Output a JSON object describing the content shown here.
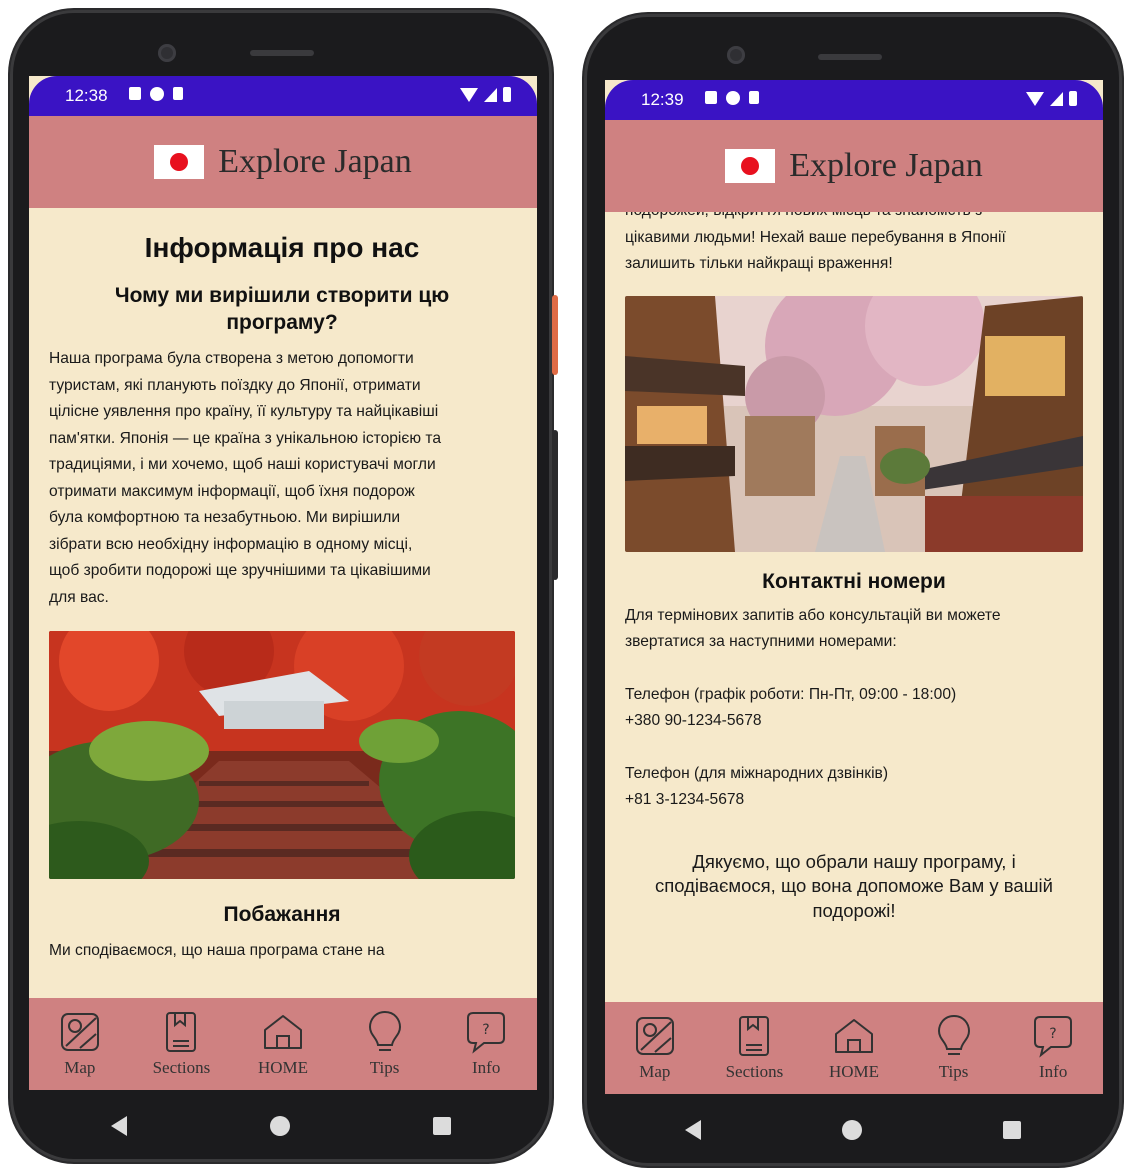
{
  "app": {
    "title": "Explore Japan"
  },
  "colors": {
    "statusbar": "#3a13c4",
    "appbar": "#cf8181",
    "background": "#f6e9cb",
    "flag_red": "#e8101e"
  },
  "left": {
    "status_time": "12:38",
    "page_title": "Інформація про нас",
    "section1_title": "Чому ми вирішили створити цю програму?",
    "section1_lines": [
      "Наша програма була створена з метою допомогти",
      "туристам, які планують поїздку до Японії, отримати",
      "цілісне уявлення про країну, її культуру та найцікавіші",
      "пам'ятки. Японія — це країна з унікальною історією та",
      "традиціями, і ми хочемо, щоб наші користувачі могли",
      "отримати максимум інформації, щоб їхня подорож",
      "була комфортною та незабутньою. Ми вирішили",
      "зібрати всю необхідну інформацію в одному місці,",
      "щоб зробити подорожі ще зручнішими та цікавішими",
      "для вас."
    ],
    "section2_title": "Побажання",
    "section2_partial": "Ми сподіваємося, що наша програма стане на"
  },
  "right": {
    "status_time": "12:39",
    "partial_lines": [
      "подорожей, відкриття нових місць та знайомств з",
      "цікавими людьми! Нехай ваше перебування в Японії",
      "залишить тільки найкращі враження!"
    ],
    "contacts_title": "Контактні номери",
    "contacts_intro": [
      "Для термінових запитів або консультацій ви можете",
      "звертатися за наступними номерами:"
    ],
    "phone1_label": "Телефон (графік роботи: Пн-Пт, 09:00 - 18:00)",
    "phone1_number": "+380 90-1234-5678",
    "phone2_label": "Телефон (для міжнародних дзвінків)",
    "phone2_number": "+81 3-1234-5678",
    "thanks_lines": [
      "Дякуємо, що обрали нашу програму, і",
      "сподіваємося, що вона допоможе Вам у вашій",
      "подорожі!"
    ]
  },
  "nav": [
    {
      "label": "Map",
      "icon": "map-icon"
    },
    {
      "label": "Sections",
      "icon": "book-icon"
    },
    {
      "label": "HOME",
      "icon": "home-icon"
    },
    {
      "label": "Tips",
      "icon": "bulb-icon"
    },
    {
      "label": "Info",
      "icon": "help-bubble-icon"
    }
  ]
}
